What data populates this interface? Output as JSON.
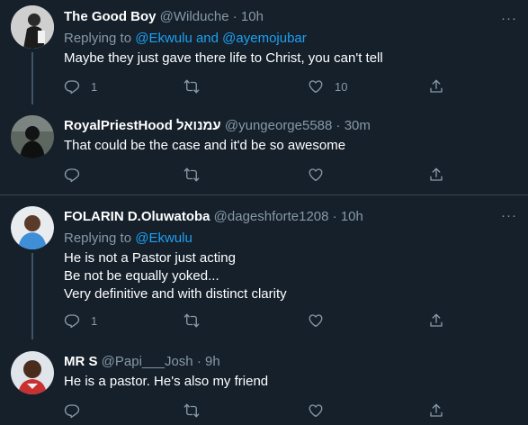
{
  "tweets": [
    {
      "display_name": "The Good Boy",
      "handle": "@Wilduche",
      "time": "· 10h",
      "replying_label": "Replying to",
      "replying_mentions": "@Ekwulu and @ayemojubar",
      "lines": [
        "Maybe they just gave there life to Christ, you can't tell"
      ],
      "reply_count": "1",
      "retweet_count": "",
      "like_count": "10"
    },
    {
      "display_name": "RoyalPriestHood עמנואל",
      "handle": "@yungeorge5588",
      "time": "· 30m",
      "lines": [
        "That could be the case and it'd be so awesome"
      ],
      "reply_count": "",
      "retweet_count": "",
      "like_count": ""
    },
    {
      "display_name": "FOLARIN D.Oluwatoba",
      "handle": "@dageshforte1208",
      "time": "· 10h",
      "replying_label": "Replying to",
      "replying_mentions": "@Ekwulu",
      "lines": [
        "He is not a Pastor just acting",
        "Be not be equally yoked...",
        "Very definitive and with distinct clarity"
      ],
      "reply_count": "1",
      "retweet_count": "",
      "like_count": ""
    },
    {
      "display_name": "MR S",
      "handle": "@Papi___Josh",
      "time": "· 9h",
      "lines": [
        "He is a pastor. He's also my friend"
      ],
      "reply_count": "",
      "retweet_count": "",
      "like_count": ""
    }
  ],
  "more_label": "···",
  "icons": {
    "reply": "reply-icon",
    "retweet": "retweet-icon",
    "like": "like-icon",
    "share": "share-icon",
    "more": "more-options-icon"
  },
  "colors": {
    "background": "#15202b",
    "secondary_text": "#8899a6",
    "link": "#1da1f2",
    "divider": "#38444d",
    "thread_line": "#3d5466"
  }
}
